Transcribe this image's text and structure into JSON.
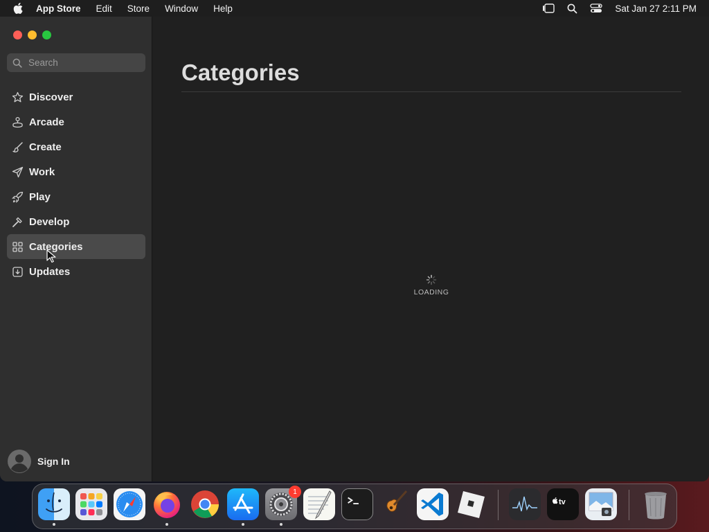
{
  "menubar": {
    "app_name": "App Store",
    "items": [
      "Edit",
      "Store",
      "Window",
      "Help"
    ],
    "datetime": "Sat Jan 27  2:11 PM"
  },
  "sidebar": {
    "search_placeholder": "Search",
    "items": [
      {
        "label": "Discover",
        "icon": "star-icon"
      },
      {
        "label": "Arcade",
        "icon": "joystick-icon"
      },
      {
        "label": "Create",
        "icon": "brush-icon"
      },
      {
        "label": "Work",
        "icon": "paper-plane-icon"
      },
      {
        "label": "Play",
        "icon": "rocket-icon"
      },
      {
        "label": "Develop",
        "icon": "hammer-icon"
      },
      {
        "label": "Categories",
        "icon": "grid-icon",
        "selected": true
      },
      {
        "label": "Updates",
        "icon": "download-icon"
      }
    ],
    "sign_in": "Sign In"
  },
  "main": {
    "title": "Categories",
    "loading_text": "LOADING"
  },
  "dock": {
    "apps": [
      "Finder",
      "Launchpad",
      "Safari",
      "Firefox",
      "Chrome",
      "App Store",
      "System Settings",
      "TextEdit",
      "Terminal",
      "GarageBand",
      "Visual Studio Code",
      "Roblox",
      "Activity Monitor",
      "Apple TV",
      "Preview",
      "Trash"
    ],
    "system_settings_badge": "1"
  },
  "colors": {
    "close": "#fe5f57",
    "minimize": "#febc2e",
    "maximize": "#28c840",
    "badge": "#ff3b30"
  }
}
